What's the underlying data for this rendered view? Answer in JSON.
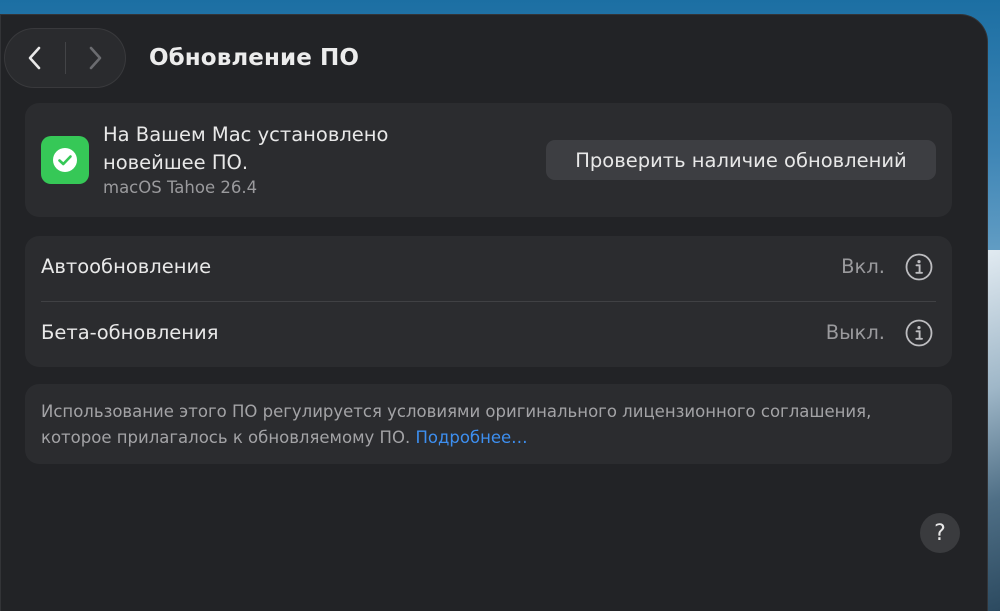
{
  "window": {
    "title": "Обновление ПО"
  },
  "nav": {
    "back_icon": "chevron-left-icon",
    "forward_icon": "chevron-right-icon"
  },
  "status": {
    "icon": "checkmark-icon",
    "icon_color": "#36c857",
    "title_line1": "На Вашем Mac установлено",
    "title_line2": "новейшее ПО.",
    "version": "macOS Tahoe 26.4",
    "check_button_label": "Проверить наличие обновлений"
  },
  "settings": {
    "auto_update": {
      "label": "Автообновление",
      "value": "Вкл."
    },
    "beta_updates": {
      "label": "Бета-обновления",
      "value": "Выкл."
    },
    "info_icon": "info-icon"
  },
  "license": {
    "text": "Использование этого ПО регулируется условиями оригинального лицензионного соглашения, которое прилагалось к обновляемому ПО. ",
    "link": "Подробнее…",
    "link_color": "#3d8ff0"
  },
  "help": {
    "label": "?"
  }
}
